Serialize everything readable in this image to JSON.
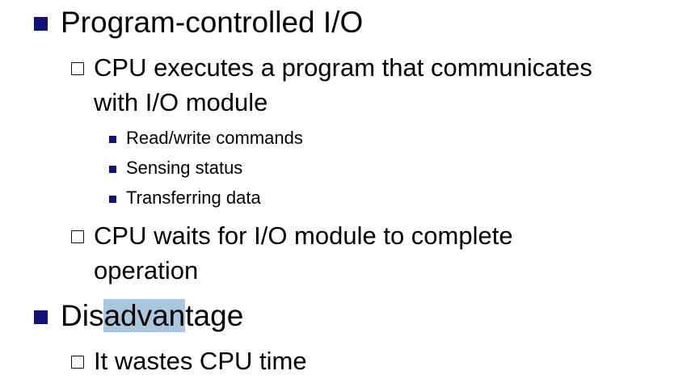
{
  "slide": {
    "items": [
      {
        "text": "Program-controlled I/O",
        "sub": [
          {
            "line1": "CPU executes a program that communicates",
            "line2": "with I/O module",
            "sub": [
              {
                "text": "Read/write commands"
              },
              {
                "text": "Sensing status"
              },
              {
                "text": "Transferring data"
              }
            ]
          },
          {
            "line1": "CPU waits for I/O module to complete",
            "line2": "operation"
          }
        ]
      },
      {
        "text_before": "Dis",
        "text_selected": "advan",
        "text_after": "tage",
        "sub": [
          {
            "line1": "It wastes CPU time"
          }
        ]
      }
    ]
  },
  "colors": {
    "bullet": "#12127a",
    "selection": "#a9c8e0",
    "text": "#000000"
  },
  "icons": {
    "level1": "filled-square-bullet",
    "level2": "hollow-square-bullet",
    "level3": "small-filled-square-bullet"
  }
}
